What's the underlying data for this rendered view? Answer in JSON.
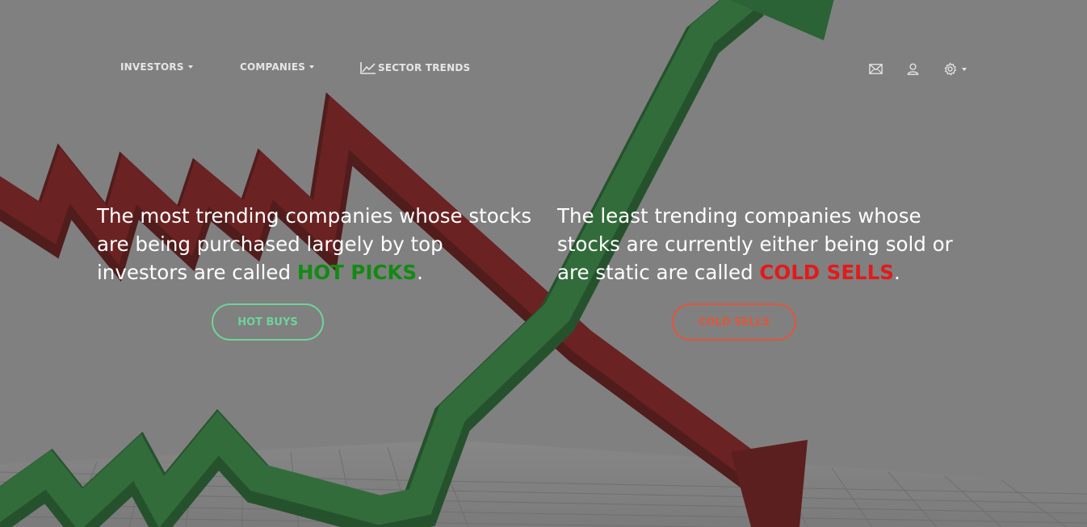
{
  "nav": {
    "investors": "INVESTORS",
    "companies": "COMPANIES",
    "sector_trends": "SECTOR TRENDS"
  },
  "header_icons": [
    "mail-icon",
    "user-icon",
    "gear-icon"
  ],
  "hot": {
    "text_before": "The most trending companies whose stocks are being purchased largely by top investors are called ",
    "highlight": "HOT PICKS",
    "text_after": ".",
    "button": "HOT BUYS"
  },
  "cold": {
    "text_before": "The least trending companies whose stocks are currently either being sold or are static are called ",
    "highlight": "COLD SELLS",
    "text_after": ".",
    "button": "COLD SELLS"
  },
  "colors": {
    "hot": "#138a13",
    "cold": "#e31a1a",
    "hot_button": "#6fd39a",
    "cold_button": "#e2553a"
  }
}
